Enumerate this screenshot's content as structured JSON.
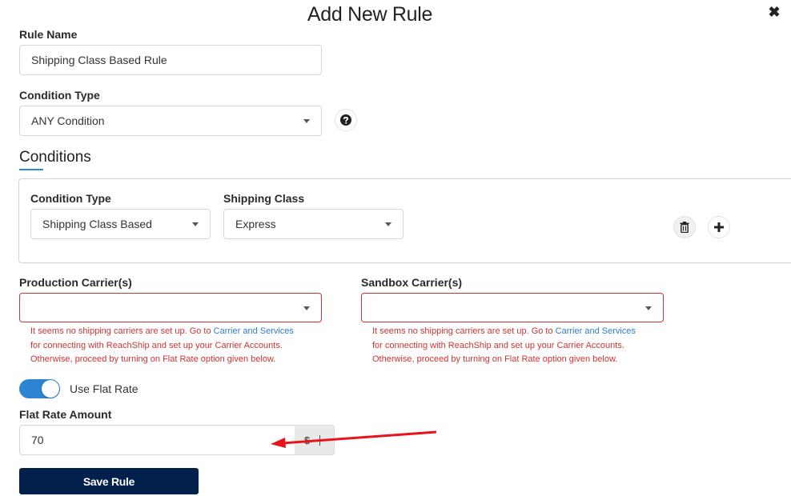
{
  "dialog": {
    "title": "Add New Rule",
    "close_icon": "close-x-icon"
  },
  "rule_name": {
    "label": "Rule Name",
    "value": "Shipping Class Based Rule"
  },
  "condition_type": {
    "label": "Condition Type",
    "value": "ANY Condition",
    "help_icon": "question-circle-icon"
  },
  "conditions": {
    "section_title": "Conditions",
    "rows": [
      {
        "condition_type_label": "Condition Type",
        "condition_type_value": "Shipping Class Based",
        "shipping_class_label": "Shipping Class",
        "shipping_class_value": "Express",
        "delete_icon": "trash-icon",
        "add_icon": "plus-icon"
      }
    ]
  },
  "production_carriers": {
    "label": "Production Carrier(s)",
    "value": "",
    "error_prefix": "It seems no shipping carriers are set up. Go to ",
    "error_link": "Carrier and Services",
    "error_line2": "for connecting with ReachShip and set up your Carrier Accounts.",
    "error_line3": "Otherwise, proceed by turning on Flat Rate option given below."
  },
  "sandbox_carriers": {
    "label": "Sandbox Carrier(s)",
    "value": "",
    "error_prefix": "It seems no shipping carriers are set up. Go to ",
    "error_link": "Carrier and Services",
    "error_line2": "for connecting with ReachShip and set up your Carrier Accounts.",
    "error_line3": "Otherwise, proceed by turning on Flat Rate option given below."
  },
  "flat_rate": {
    "toggle_label": "Use Flat Rate",
    "toggle_on": true,
    "amount_label": "Flat Rate Amount",
    "amount_value": "70",
    "currency_symbol": "$"
  },
  "actions": {
    "save_label": "Save Rule"
  },
  "annotation": {
    "arrow_color": "#e8141b"
  }
}
